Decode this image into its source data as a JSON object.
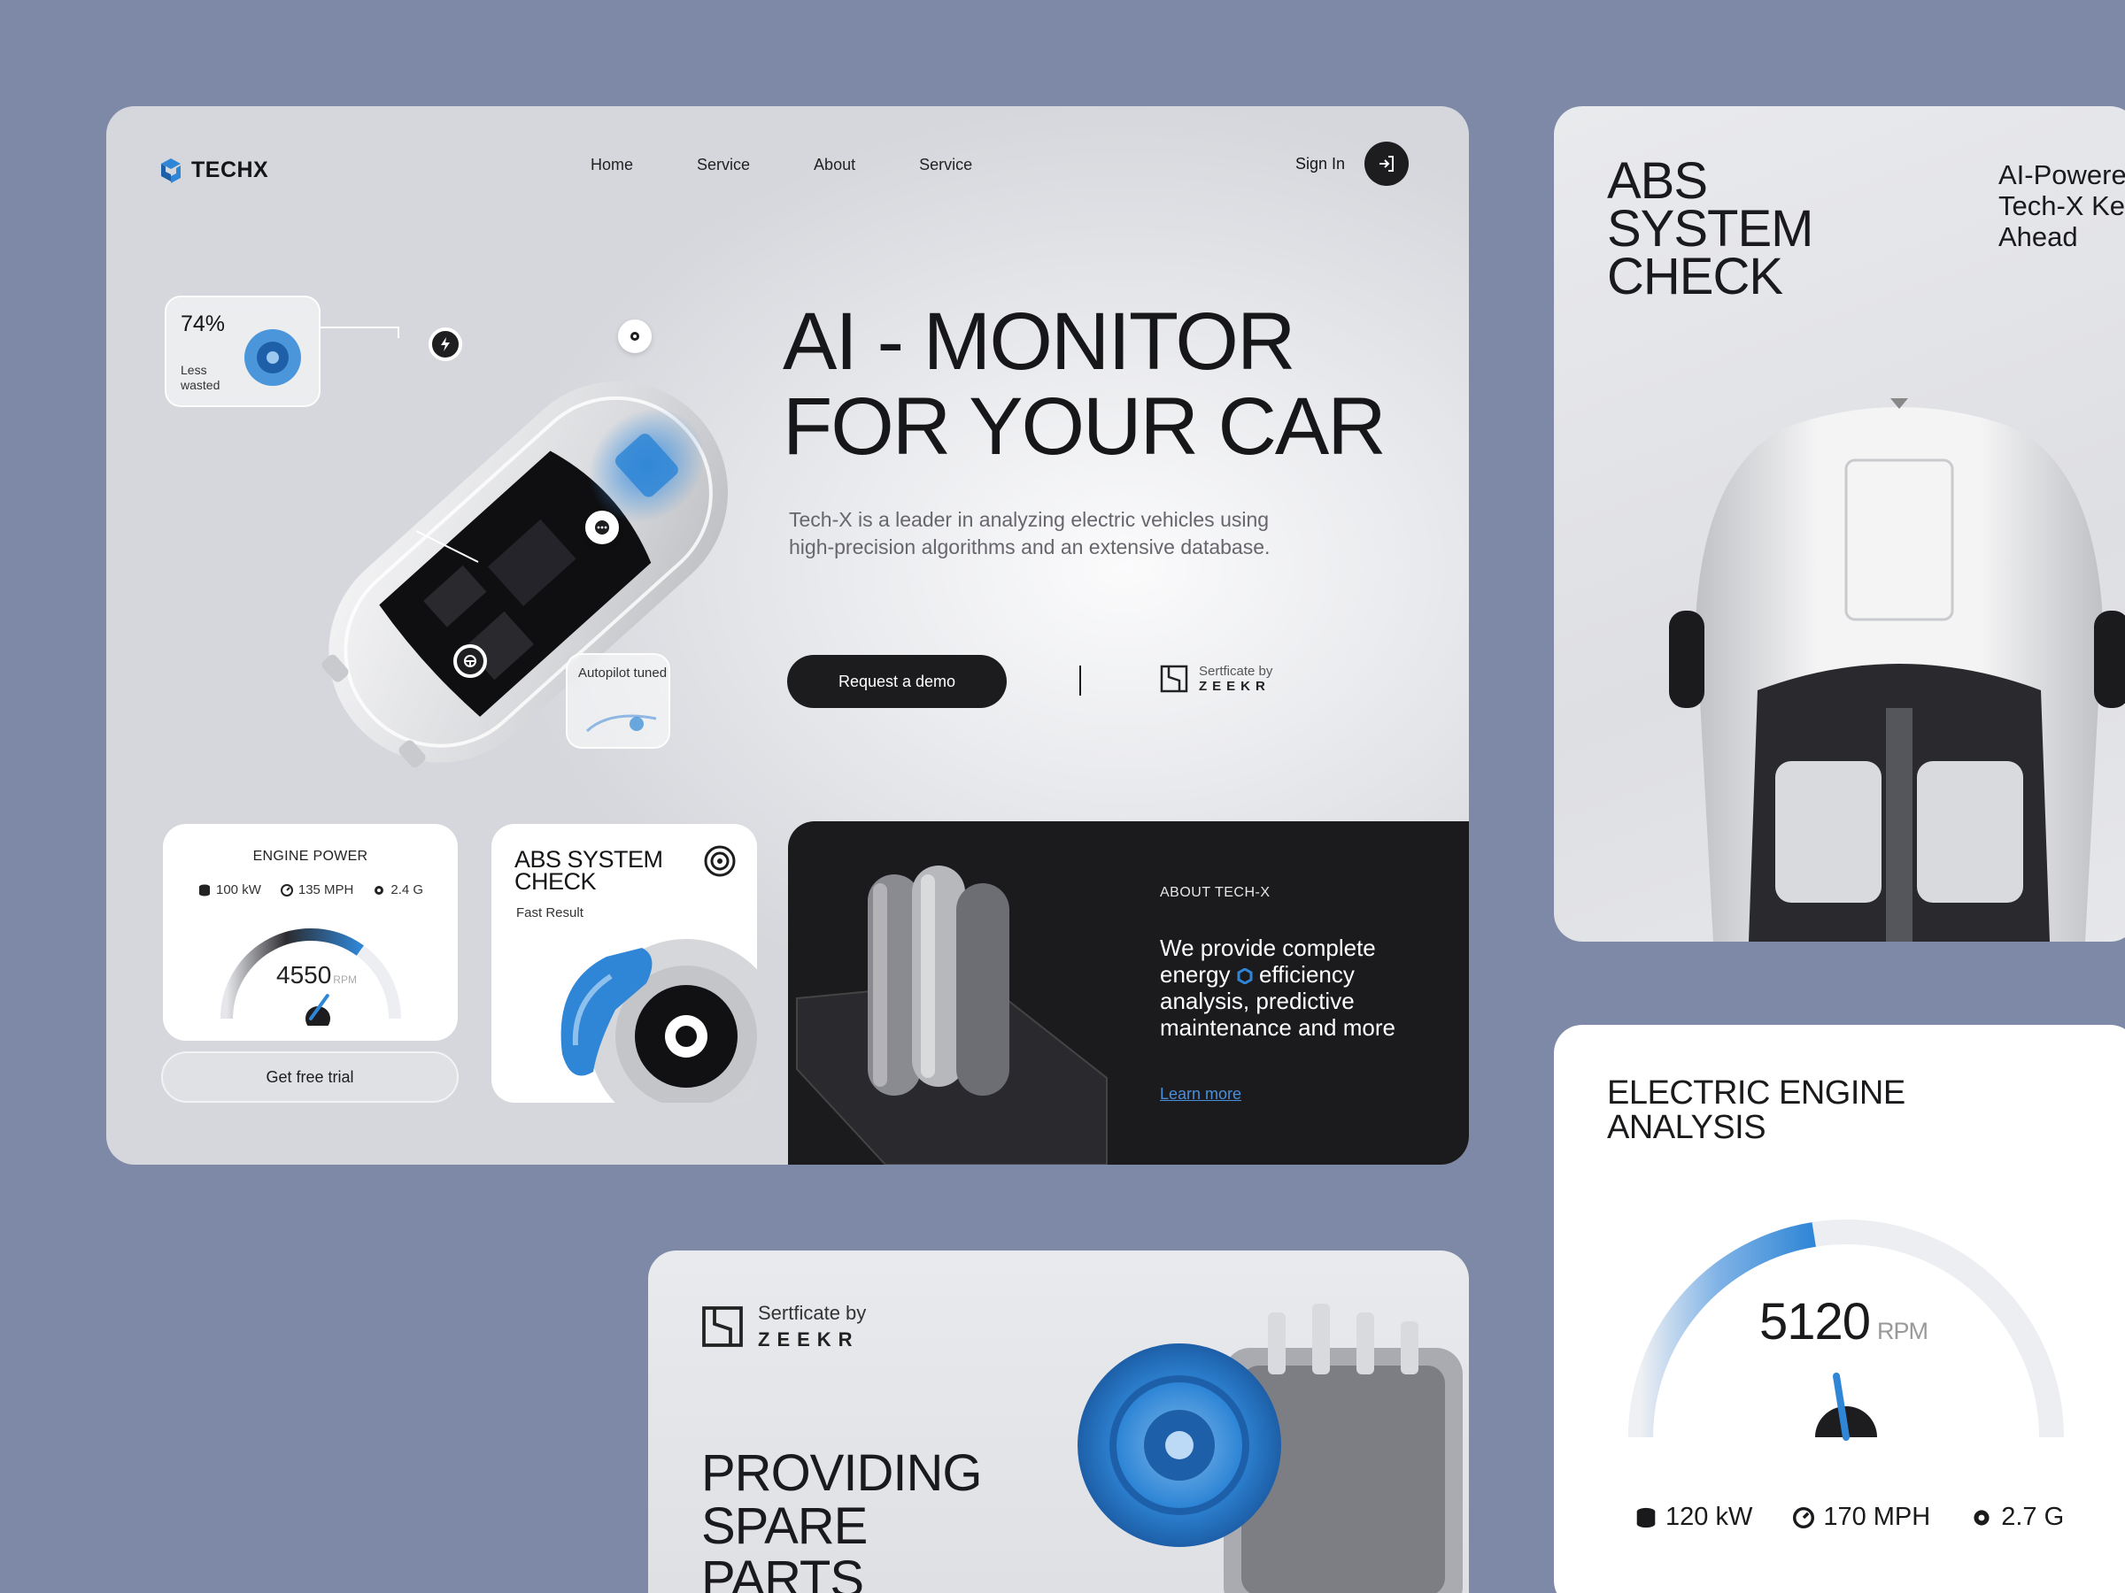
{
  "header": {
    "logo_text": "TECHX",
    "nav": [
      "Home",
      "Service",
      "About",
      "Service"
    ],
    "signin_label": "Sign In"
  },
  "hero": {
    "title_line1": "AI - MONITOR",
    "title_line2": "FOR YOUR CAR",
    "description": "Tech-X is a leader in analyzing electric vehicles using high-precision algorithms and an extensive database.",
    "cta_label": "Request a demo",
    "cert_prefix": "Sertficate by",
    "cert_brand": "ZEEKR",
    "callout_percent": "74%",
    "callout_percent_label": "Less wasted",
    "callout_autopilot": "Autopilot tuned"
  },
  "engine_power": {
    "title": "ENGINE POWER",
    "stat_kw": "100 kW",
    "stat_mph": "135 MPH",
    "stat_g": "2.4 G",
    "rpm_value": "4550",
    "rpm_unit": "RPM",
    "gauge_fill": 0.7,
    "trial_label": "Get free trial"
  },
  "abs_mini": {
    "title": "ABS SYSTEM CHECK",
    "subtitle": "Fast Result"
  },
  "about": {
    "label": "ABOUT TECH-X",
    "text_part1": "We provide complete energy",
    "text_part2": "efficiency analysis, predictive maintenance and more",
    "link": "Learn more"
  },
  "abs_card": {
    "title": "ABS SYSTEM CHECK",
    "side_line1": "AI-Powere",
    "side_line2": "Tech-X Ke",
    "side_line3": "Ahead"
  },
  "electric_engine": {
    "title_line1": "ELECTRIC ENGINE",
    "title_line2": "ANALYSIS",
    "rpm_value": "5120",
    "rpm_unit": "RPM",
    "gauge_fill": 0.45,
    "stat_kw": "120 kW",
    "stat_mph": "170 MPH",
    "stat_g": "2.7 G"
  },
  "spare_parts": {
    "cert_prefix": "Sertficate by",
    "cert_brand": "ZEEKR",
    "title_line1": "PROVIDING",
    "title_line2": "SPARE",
    "title_line3": "PARTS"
  },
  "colors": {
    "background": "#7d89a6",
    "accent_blue": "#2f86d6",
    "dark": "#1b1b1e",
    "card_light": "#e9eaed"
  },
  "icons": [
    "logo-icon",
    "sign-in-icon",
    "bolt-icon",
    "gear-icon",
    "more-icon",
    "steering-icon",
    "database-icon",
    "speedometer-icon",
    "brake-disc-icon",
    "hexagon-icon",
    "zeekr-logo-icon"
  ]
}
